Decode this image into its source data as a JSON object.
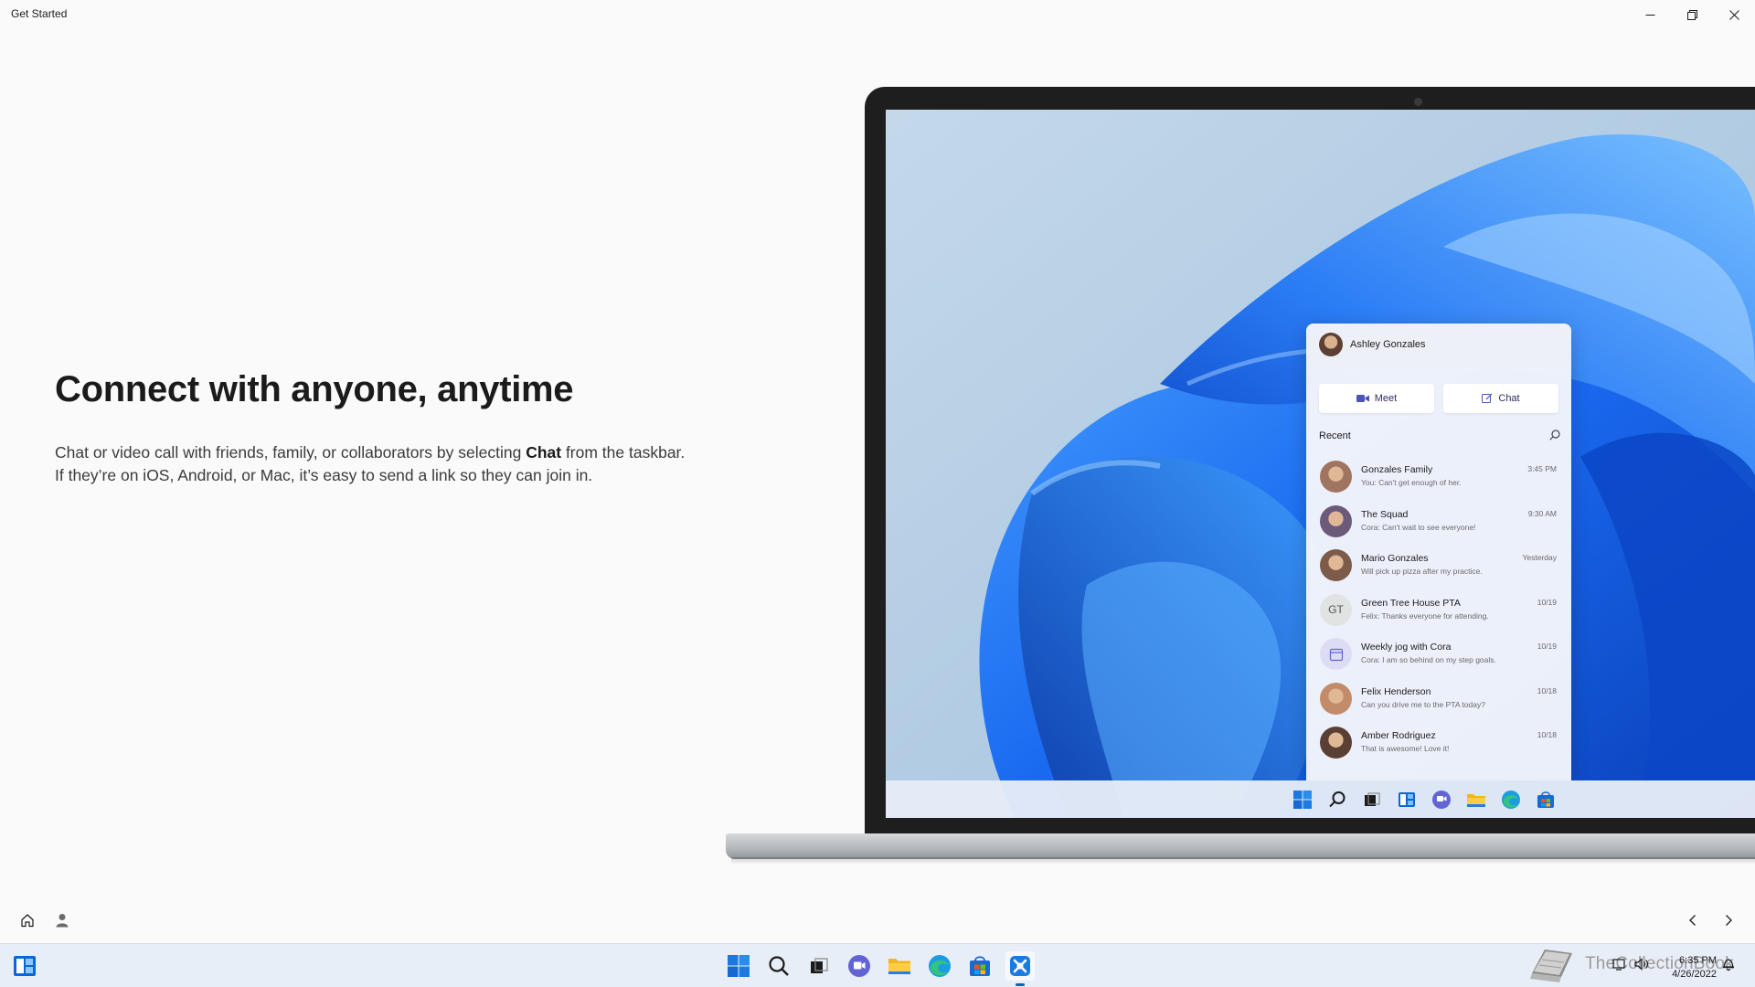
{
  "window": {
    "title": "Get Started"
  },
  "hero": {
    "title": "Connect with anyone, anytime",
    "body_before": "Chat or video call with friends, family, or collaborators by selecting ",
    "body_bold": "Chat",
    "body_after": " from the taskbar. If they’re on iOS, Android, or Mac, it’s easy to send a link so they can join in."
  },
  "illustration": {
    "flyout": {
      "user_name": "Ashley Gonzales",
      "meet_label": "Meet",
      "chat_label": "Chat",
      "recent_label": "Recent",
      "items": [
        {
          "name": "Gonzales Family",
          "message": "You: Can't get enough of her.",
          "time": "3:45 PM",
          "avatar": "photo",
          "color": "#a07560"
        },
        {
          "name": "The Squad",
          "message": "Cora: Can't wait to see everyone!",
          "time": "9:30 AM",
          "avatar": "photo",
          "color": "#6b5a7a"
        },
        {
          "name": "Mario Gonzales",
          "message": "Will pick up pizza after my practice.",
          "time": "Yesterday",
          "avatar": "photo",
          "color": "#7d5b49"
        },
        {
          "name": "Green Tree House PTA",
          "message": "Felix: Thanks everyone for attending.",
          "time": "10/19",
          "avatar": "GT",
          "color": "#dfe3e1"
        },
        {
          "name": "Weekly jog with Cora",
          "message": "Cora: I am so behind on my step goals.",
          "time": "10/19",
          "avatar": "calendar",
          "color": "#dcdcf5"
        },
        {
          "name": "Felix Henderson",
          "message": "Can you drive me to the PTA today?",
          "time": "10/18",
          "avatar": "photo",
          "color": "#c28b6a"
        },
        {
          "name": "Amber Rodriguez",
          "message": "That is awesome! Love it!",
          "time": "10/18",
          "avatar": "photo",
          "color": "#5a3f35"
        }
      ]
    },
    "taskbar_icons": [
      "windows-logo-icon",
      "search-icon",
      "task-view-icon",
      "widgets-icon",
      "chat-icon",
      "file-explorer-icon",
      "edge-icon",
      "store-icon"
    ]
  },
  "taskbar": {
    "watermark_text": "TheCollectionBook",
    "time": "6:35 PM",
    "date": "4/26/2022",
    "accent": "#0067c0"
  }
}
